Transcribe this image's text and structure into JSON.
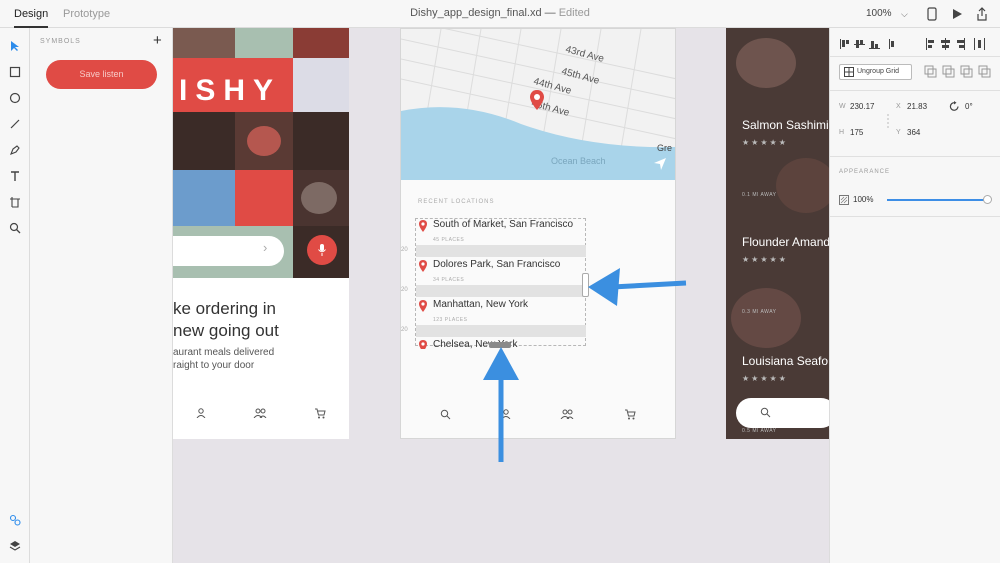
{
  "topbar": {
    "tabs": [
      "Design",
      "Prototype"
    ],
    "file_title": "Dishy_app_design_final.xd",
    "separator": " — ",
    "status": "Edited",
    "zoom": "100%"
  },
  "symbols_panel": {
    "label": "SYMBOLS",
    "symbol_button": "Save listen"
  },
  "artboard_home": {
    "brand": "ISHY",
    "headline_lines": [
      "ke ordering in",
      "new going out"
    ],
    "subline_lines": [
      "aurant meals delivered",
      "raight to your door"
    ],
    "colors": {
      "accent": "#e04b45",
      "dark": "#3b2b27",
      "teal": "#a8bfb0",
      "blue": "#6c9ccc"
    }
  },
  "artboard_locations": {
    "map_labels": {
      "street_1": "43rd Ave",
      "street_2": "45th Ave",
      "street_3": "44th Ave",
      "street_4": "46th Ave",
      "beach": "Ocean Beach",
      "edge": "Gre"
    },
    "recent_label": "RECENT LOCATIONS",
    "locations": [
      {
        "name": "South of Market, San Francisco",
        "count": "45 PLACES"
      },
      {
        "name": "Dolores Park, San Francisco",
        "count": "34 PLACES"
      },
      {
        "name": "Manhattan, New York",
        "count": "123 PLACES"
      },
      {
        "name": "Chelsea, New York",
        "count": ""
      }
    ],
    "gap_value": "20"
  },
  "artboard_dishes": {
    "dishes": [
      {
        "name": "Salmon Sashimi",
        "meta": "0.1 MI AWAY"
      },
      {
        "name": "Flounder Amand",
        "meta": "0.3 MI AWAY"
      },
      {
        "name": "Louisiana Seafo",
        "meta": "0.5 MI AWAY"
      }
    ],
    "stars": "★★★★★"
  },
  "properties_panel": {
    "ungroup_label": "Ungroup Grid",
    "w_label": "W",
    "w_value": "230.17",
    "x_label": "X",
    "x_value": "21.83",
    "rotation_value": "0°",
    "h_label": "H",
    "h_value": "175",
    "y_label": "Y",
    "y_value": "364",
    "appearance_label": "APPEARANCE",
    "opacity_value": "100%",
    "opacity_fraction": 1.0
  }
}
